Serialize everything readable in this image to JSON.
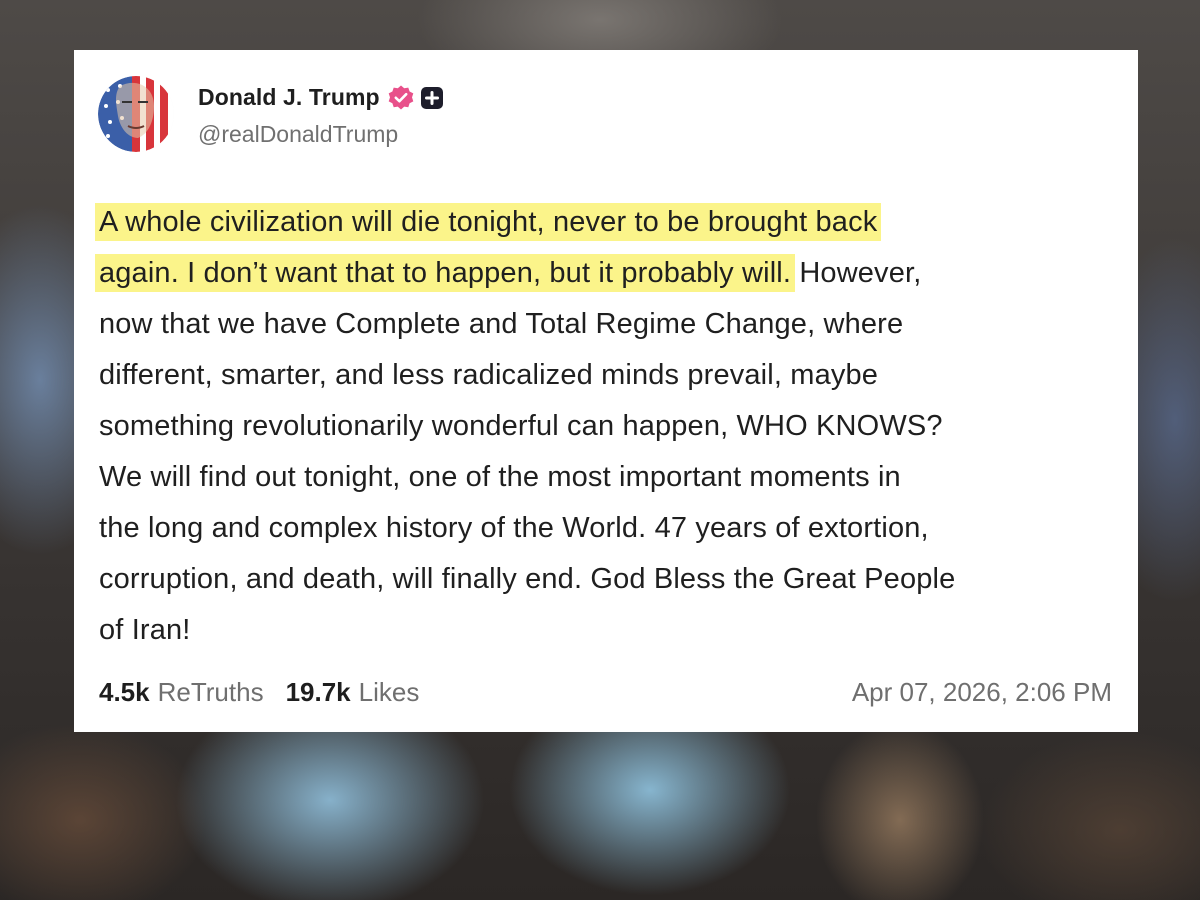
{
  "post": {
    "display_name": "Donald J. Trump",
    "handle": "@realDonaldTrump",
    "badges": [
      "verified-icon",
      "plus-icon"
    ],
    "body_lines": [
      {
        "highlight": "A whole civilization will die tonight, never to be brought back",
        "rest": ""
      },
      {
        "highlight": "again. I don’t want that to happen, but it probably will.",
        "rest": " However,"
      },
      {
        "highlight": "",
        "rest": "now that we have Complete and Total Regime Change, where"
      },
      {
        "highlight": "",
        "rest": "different, smarter, and less radicalized minds prevail, maybe"
      },
      {
        "highlight": "",
        "rest": "something revolutionarily wonderful can happen, WHO KNOWS?"
      },
      {
        "highlight": "",
        "rest": "We will find out tonight, one of the most important moments in"
      },
      {
        "highlight": "",
        "rest": "the long and complex history of the World. 47 years of extortion,"
      },
      {
        "highlight": "",
        "rest": "corruption, and death, will finally end. God Bless the Great People"
      },
      {
        "highlight": "",
        "rest": "of Iran!"
      }
    ],
    "retruths_count": "4.5k",
    "retruths_label": "ReTruths",
    "likes_count": "19.7k",
    "likes_label": "Likes",
    "timestamp": "Apr 07, 2026, 2:06 PM"
  },
  "colors": {
    "highlight": "#fbf48a",
    "verified_badge": "#e8508a",
    "plus_badge": "#1d1d2b",
    "text_primary": "#1f1f1f",
    "text_secondary": "#6f6f6f"
  }
}
